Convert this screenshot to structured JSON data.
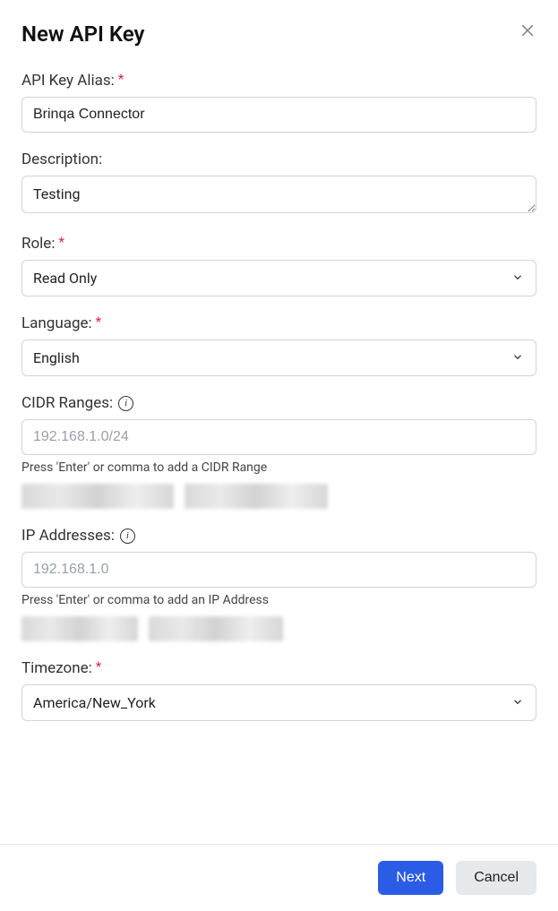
{
  "modal": {
    "title": "New API Key"
  },
  "fields": {
    "alias": {
      "label": "API Key Alias:",
      "value": "Brinqa Connector"
    },
    "description": {
      "label": "Description:",
      "value": "Testing"
    },
    "role": {
      "label": "Role:",
      "value": "Read Only"
    },
    "language": {
      "label": "Language:",
      "value": "English"
    },
    "cidr": {
      "label": "CIDR Ranges:",
      "placeholder": "192.168.1.0/24",
      "hint": "Press 'Enter' or comma to add a CIDR Range"
    },
    "ip": {
      "label": "IP Addresses:",
      "placeholder": "192.168.1.0",
      "hint": "Press 'Enter' or comma to add an IP Address"
    },
    "timezone": {
      "label": "Timezone:",
      "value": "America/New_York"
    }
  },
  "buttons": {
    "next": "Next",
    "cancel": "Cancel"
  }
}
